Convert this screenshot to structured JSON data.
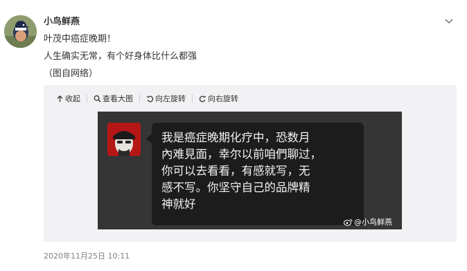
{
  "post": {
    "username": "小鸟鲜燕",
    "lines": [
      "叶茂中癌症晚期！",
      "人生确实无常，有个好身体比什么都强",
      "（图自网络）"
    ],
    "timestamp": "2020年11月25日 10:11"
  },
  "toolbar": {
    "collapse_label": "收起",
    "view_large_label": "查看大图",
    "rotate_left_label": "向左旋转",
    "rotate_right_label": "向右旋转"
  },
  "image": {
    "message_lines": [
      "我是癌症晚期化疗中，恐数月",
      "內难見面，幸尔以前咱們聊过，",
      "你可以去看看，有感就写，无",
      "感不写。你坚守自己的品牌精",
      "神就好"
    ],
    "watermark": "@小鸟鲜燕"
  },
  "icons": {
    "collapse": "arrow-up-icon",
    "view_large": "magnifier-icon",
    "rotate_left": "rotate-left-icon",
    "rotate_right": "rotate-right-icon",
    "menu": "chevron-down-icon",
    "watermark_logo": "weibo-logo-icon"
  },
  "colors": {
    "text": "#333333",
    "muted": "#808080",
    "media_background": "#f2f2f5",
    "photo_background": "#353535",
    "bubble": "#1c1c1c"
  }
}
